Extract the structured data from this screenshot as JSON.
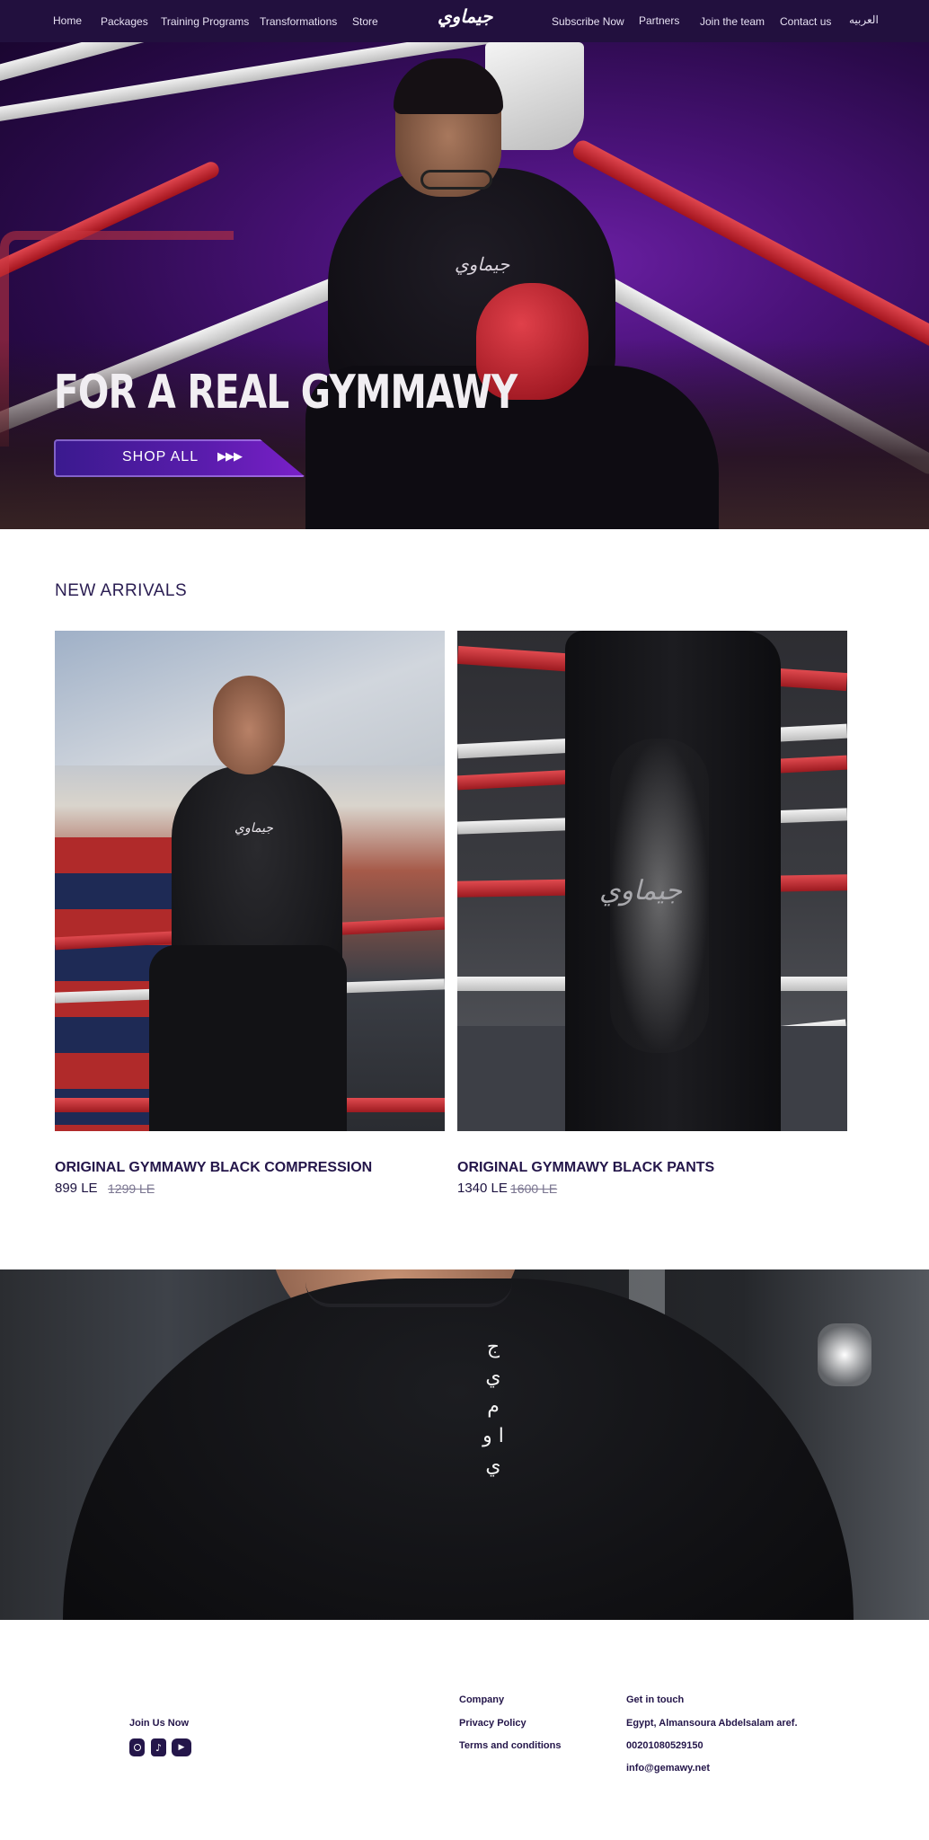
{
  "nav": {
    "home": "Home",
    "packages": "Packages",
    "training_programs": "Training Programs",
    "transformations": "Transformations",
    "store": "Store",
    "logo": "جيماوي",
    "subscribe": "Subscribe Now",
    "partners": "Partners",
    "join_team": "Join the team",
    "contact": "Contact us",
    "language": "العربيه"
  },
  "hero": {
    "title": "FOR A REAL GYMMAWY",
    "shop_button": "SHOP ALL",
    "shop_arrows": "▶▶▶",
    "shirt_print": "جيماوي"
  },
  "new_arrivals": {
    "title": "NEW ARRIVALS",
    "products": [
      {
        "name": "ORIGINAL GYMMAWY BLACK COMPRESSION",
        "price": "899 LE",
        "old_price": "1299 LE",
        "print": "جيماوي"
      },
      {
        "name": "ORIGINAL GYMMAWY BLACK PANTS",
        "price": "1340 LE",
        "old_price": "1600 LE",
        "print": "جيماوي"
      }
    ]
  },
  "banner": {
    "back_print": "ج ي م ا و ي"
  },
  "footer": {
    "join_us": "Join Us Now",
    "social": [
      "instagram-icon",
      "tiktok-icon",
      "youtube-icon"
    ],
    "company": {
      "heading": "Company",
      "privacy": "Privacy Policy",
      "terms": "Terms and conditions"
    },
    "contact": {
      "heading": "Get in touch",
      "address": "Egypt, Almansoura Abdelsalam aref.",
      "phone": "00201080529150",
      "email": "info@gemawy.net"
    }
  },
  "colors": {
    "nav_bg": "#22103e",
    "brand_dark": "#24164a",
    "accent_purple": "#5a1cad"
  }
}
